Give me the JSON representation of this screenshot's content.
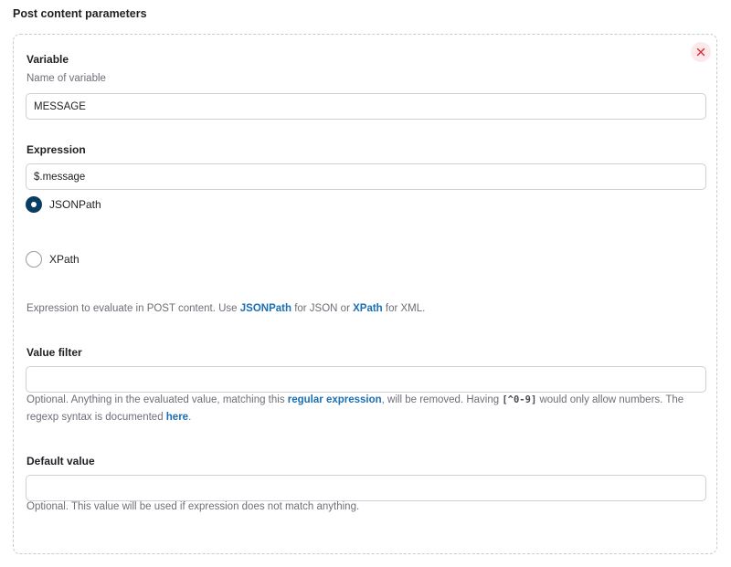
{
  "section": {
    "title": "Post content parameters"
  },
  "variable": {
    "label": "Variable",
    "description": "Name of variable",
    "value": "MESSAGE"
  },
  "expression": {
    "label": "Expression",
    "value": "$.message",
    "options": [
      {
        "label": "JSONPath",
        "checked": true
      },
      {
        "label": "XPath",
        "checked": false
      }
    ],
    "help": {
      "part1": "Expression to evaluate in POST content. Use ",
      "link1": "JSONPath",
      "part2": " for JSON or ",
      "link2": "XPath",
      "part3": " for XML."
    }
  },
  "value_filter": {
    "label": "Value filter",
    "value": "",
    "help": {
      "part1": "Optional. Anything in the evaluated value, matching this ",
      "link1": "regular expression",
      "part2": ", will be removed. Having ",
      "code": "[^0-9]",
      "part3": " would only allow numbers. The regexp syntax is documented ",
      "link2": "here",
      "part4": "."
    }
  },
  "default_value": {
    "label": "Default value",
    "value": "",
    "help": "Optional. This value will be used if expression does not match anything."
  },
  "colors": {
    "accent": "#0a3d62",
    "link": "#1a6fb5",
    "danger": "#d92d3a",
    "danger_bg": "#fde8ea"
  },
  "icons": {
    "close": "close-icon"
  }
}
